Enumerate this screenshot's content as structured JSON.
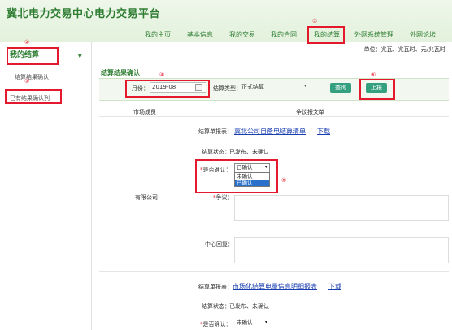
{
  "app": {
    "title": "冀北电力交易中心电力交易平台"
  },
  "nav": [
    "我的主页",
    "基本信息",
    "我的交易",
    "我的合同",
    "我的结算",
    "外网系统管理",
    "外网论坛"
  ],
  "unit_text": "单位：兆瓦、兆瓦时、元/兆瓦时",
  "sidebar": {
    "heading": "我的结算",
    "items": [
      "结算结果确认",
      "已有结果确认列"
    ]
  },
  "main": {
    "title": "结算结果确认"
  },
  "filter": {
    "month_label": "月份：",
    "month_value": "2019-08",
    "type_label": "结算类型：",
    "type_value": "正式结算",
    "query_label": "查询",
    "report_label": "上报"
  },
  "table": {
    "headers": [
      "市场成员",
      "争议报文单"
    ]
  },
  "row": {
    "member": "有限公司",
    "doc_label": "结算单报表：",
    "doc_link": "冀北公司自备电结算清单",
    "doc_download": "下载",
    "status_label": "结算状态：",
    "status_value": "已发布、未确认",
    "confirm_label": "是否确认：",
    "confirm_value": "已确认",
    "options": [
      "未确认",
      "已确认"
    ],
    "dispute_label": "争议：",
    "center_label": "中心回复："
  },
  "row2": {
    "doc_label": "结算单报表：",
    "doc_link": "市场化结算电量信息明细报表",
    "doc_download": "下载",
    "status_label": "结算状态：",
    "status_value": "已发布、未确认",
    "confirm_label": "是否确认：",
    "confirm_value": "未确认"
  },
  "annotations": [
    "①",
    "②",
    "③",
    "④",
    "⑤",
    "⑥"
  ],
  "colors": {
    "brand": "#2e7d32",
    "accent": "#35a080",
    "annotation": "#e5192d",
    "link": "#1a3fb0"
  }
}
